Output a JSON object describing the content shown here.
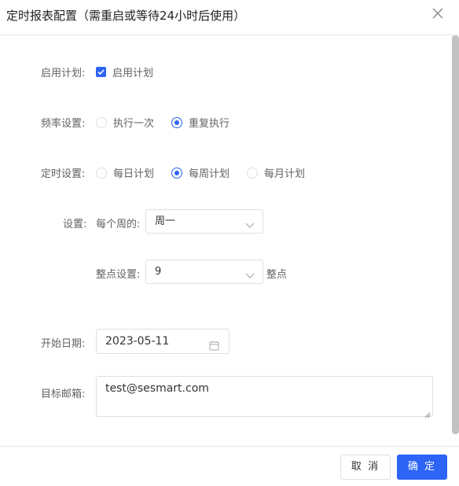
{
  "dialog": {
    "title": "定时报表配置（需重启或等待24小时后使用）",
    "close_icon": "close-icon"
  },
  "form": {
    "enable": {
      "label": "启用计划:",
      "checkbox_label": "启用计划",
      "checked": true
    },
    "frequency": {
      "label": "频率设置:",
      "options": [
        "执行一次",
        "重复执行"
      ],
      "selected": "重复执行"
    },
    "schedule": {
      "label": "定时设置:",
      "options": [
        "每日计划",
        "每周计划",
        "每月计划"
      ],
      "selected": "每周计划"
    },
    "settings": {
      "label": "设置:",
      "weekday_label": "每个周的:",
      "weekday_value": "周一",
      "hour_label": "整点设置:",
      "hour_value": "9",
      "hour_suffix": "整点"
    },
    "start_date": {
      "label": "开始日期:",
      "value": "2023-05-11"
    },
    "email": {
      "label": "目标邮箱:",
      "value": "test@sesmart.com"
    }
  },
  "footer": {
    "cancel_label": "取 消",
    "ok_label": "确 定"
  },
  "colors": {
    "primary": "#2d64f6",
    "border": "#dcdfe6",
    "label": "#606266"
  }
}
